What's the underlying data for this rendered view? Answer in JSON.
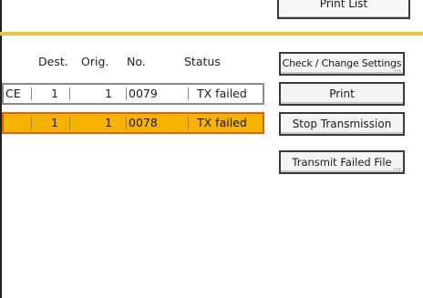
{
  "top_button": {
    "label": "Print List"
  },
  "columns": [
    "Dest.",
    "Orig.",
    "No.",
    "Status"
  ],
  "rows": [
    {
      "name": "CE",
      "dest": "1",
      "orig": "1",
      "no": "0079",
      "status": "TX failed",
      "selected": false
    },
    {
      "name": "",
      "dest": "1",
      "orig": "1",
      "no": "0078",
      "status": "TX failed",
      "selected": true
    }
  ],
  "buttons": {
    "check_change": "Check / Change Settings",
    "print": "Print",
    "stop": "Stop Transmission",
    "transmit_failed": "Transmit Failed File",
    "more_marker": "..."
  },
  "colors": {
    "accent_line": "#f0c23a",
    "selected_row_fill": "#f5b300",
    "selected_row_border": "#e65c12"
  }
}
